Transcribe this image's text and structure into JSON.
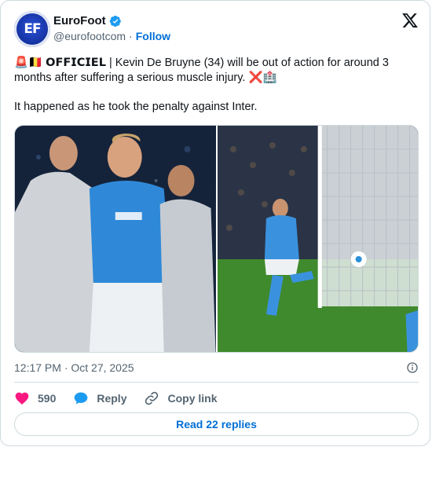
{
  "account": {
    "display_name": "EuroFoot",
    "handle": "@eurofootcom",
    "separator": "·",
    "follow_label": "Follow",
    "avatar_text": "EF",
    "verified_color": "#1d9bf0"
  },
  "tweet": {
    "line1": "🚨🇧🇪 𝗢𝗙𝗙𝗜𝗖𝗜𝗘𝗟 | Kevin De Bruyne (34) will be out of action for around 3 months after suffering a serious muscle injury. ❌🏥",
    "line2": "It happened as he took the penalty against Inter."
  },
  "media": {
    "left_photo": "injured-player-helped-off-photo",
    "right_photo": "penalty-kick-photo"
  },
  "meta": {
    "timestamp": "12:17 PM · Oct 27, 2025"
  },
  "actions": {
    "like_count": "590",
    "reply_label": "Reply",
    "copy_link_label": "Copy link"
  },
  "footer": {
    "read_replies_label": "Read 22 replies"
  },
  "colors": {
    "accent": "#006fd6",
    "like": "#f91880",
    "reply_bubble": "#1d9bf0",
    "muted_text": "#536471",
    "border": "#cfd9de"
  }
}
